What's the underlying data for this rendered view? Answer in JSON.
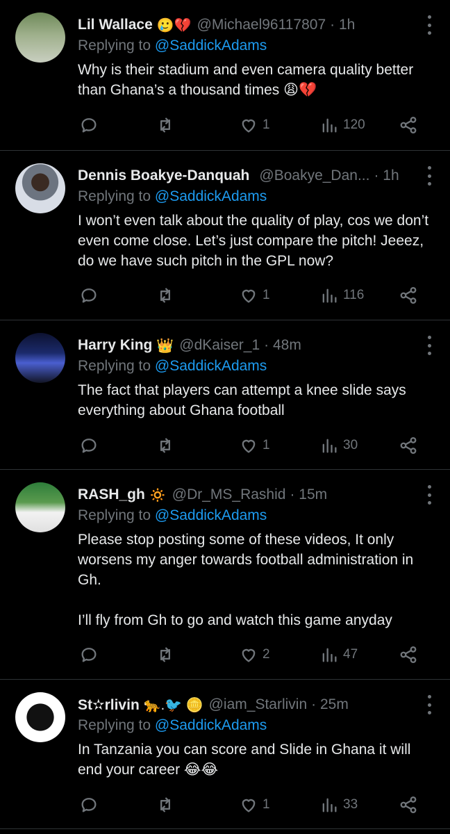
{
  "replying_label": "Replying to",
  "tweets": [
    {
      "name": "Lil Wallace",
      "name_emoji": "🥲💔",
      "handle": "@Michael96117807",
      "time": "· 1h",
      "reply_to": "@SaddickAdams",
      "text": "Why is their stadium and even camera quality better than Ghana’s a thousand times 😩💔",
      "likes": "1",
      "views": "120",
      "avatar_colors": [
        "#6f8a5a",
        "#c9cfc0"
      ]
    },
    {
      "name": "Dennis Boakye-Danquah",
      "name_emoji": "",
      "handle": "@Boakye_Dan...",
      "time": "· 1h",
      "reply_to": "@SaddickAdams",
      "text": "I won’t even talk about the quality of play, cos we don’t even come close. Let’s just compare the pitch! Jeeez, do we have such pitch in the GPL now?",
      "likes": "1",
      "views": "116",
      "avatar_colors": [
        "#3a2a22",
        "#d8dde6"
      ]
    },
    {
      "name": "Harry King",
      "name_emoji": "👑",
      "handle": "@dKaiser_1",
      "time": "· 48m",
      "reply_to": "@SaddickAdams",
      "text": "The fact that players can attempt a knee slide says everything about Ghana football",
      "likes": "1",
      "views": "30",
      "avatar_colors": [
        "#1b2a6b",
        "#4a5fd0"
      ]
    },
    {
      "name": "RASH_gh",
      "name_emoji": "🔅",
      "handle": "@Dr_MS_Rashid",
      "time": "· 15m",
      "reply_to": "@SaddickAdams",
      "text": "Please stop posting some of these videos, It only worsens my anger towards football administration in Gh.\n\nI’ll fly from Gh to go and watch this game anyday",
      "likes": "2",
      "views": "47",
      "avatar_colors": [
        "#2e7d3a",
        "#f2f2f2"
      ]
    },
    {
      "name": "St✫rlivin",
      "name_emoji": "🐆.🐦 🪙",
      "handle": "@iam_Starlivin",
      "time": "· 25m",
      "reply_to": "@SaddickAdams",
      "text": "In Tanzania you can score and Slide in Ghana it will end your career 😂😂",
      "likes": "1",
      "views": "33",
      "avatar_colors": [
        "#ffffff",
        "#111111"
      ]
    }
  ]
}
